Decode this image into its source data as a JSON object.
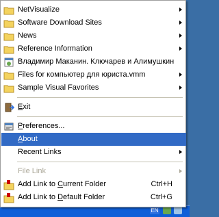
{
  "menu": {
    "favorites": [
      {
        "label": "NetVisualize",
        "submenu": true
      },
      {
        "label": "Software Download Sites",
        "submenu": true
      },
      {
        "label": "News",
        "submenu": true
      },
      {
        "label": "Reference Information",
        "submenu": true
      },
      {
        "label": "Владимир Маканин. Ключарев и Алимушкин",
        "submenu": false
      },
      {
        "label": "Files for компьютер для юриста.vmm",
        "submenu": true
      },
      {
        "label": "Sample Visual Favorites",
        "submenu": true
      }
    ],
    "exit": {
      "label": "Exit",
      "underline": "E",
      "rest": "xit"
    },
    "preferences": {
      "underline": "P",
      "rest": "references..."
    },
    "about": {
      "underline": "A",
      "rest": "bout"
    },
    "recent_links": {
      "label": "Recent Links",
      "underline": "L"
    },
    "file_link": {
      "label": "File Link"
    },
    "add_current": {
      "pre": "Add Link to ",
      "underline": "C",
      "rest": "urrent Folder",
      "shortcut": "Ctrl+H"
    },
    "add_default": {
      "pre": "Add Link to ",
      "underline": "D",
      "rest": "efault Folder",
      "shortcut": "Ctrl+G"
    }
  },
  "taskbar": {
    "language": "EN"
  },
  "colors": {
    "highlight": "#316ac5",
    "folder": "#f4d35e",
    "disabled": "#aca899"
  }
}
